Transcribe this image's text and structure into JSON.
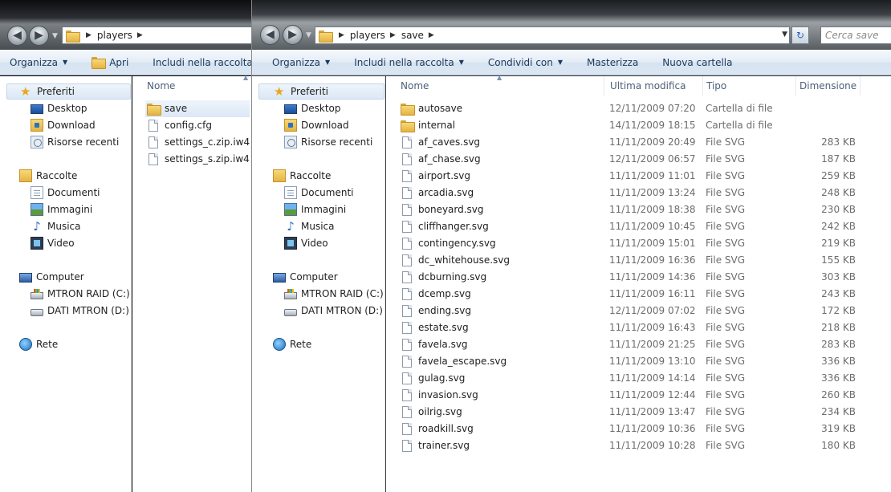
{
  "colors": {
    "toolbar_text": "#1e395b",
    "header_text": "#4c607a",
    "meta_text": "#6d6d6d",
    "selection": "#dbe8f6"
  },
  "left_window": {
    "path": [
      "players"
    ],
    "toolbar": [
      {
        "label": "Organizza",
        "dropdown": true,
        "icon": ""
      },
      {
        "label": "Apri",
        "dropdown": false,
        "icon": "open-folder-icon"
      },
      {
        "label": "Includi nella raccolta",
        "dropdown": true,
        "icon": ""
      }
    ],
    "column_name": "Nome",
    "files": [
      {
        "name": "save",
        "kind": "folder",
        "selected": true
      },
      {
        "name": "config.cfg",
        "kind": "file",
        "selected": false
      },
      {
        "name": "settings_c.zip.iw4",
        "kind": "file",
        "selected": false
      },
      {
        "name": "settings_s.zip.iw4",
        "kind": "file",
        "selected": false
      }
    ]
  },
  "right_window": {
    "path": [
      "players",
      "save"
    ],
    "search_placeholder": "Cerca save",
    "toolbar": [
      {
        "label": "Organizza",
        "dropdown": true
      },
      {
        "label": "Includi nella raccolta",
        "dropdown": true
      },
      {
        "label": "Condividi con",
        "dropdown": true
      },
      {
        "label": "Masterizza",
        "dropdown": false
      },
      {
        "label": "Nuova cartella",
        "dropdown": false
      }
    ],
    "columns": {
      "name": "Nome",
      "modified": "Ultima modifica",
      "type": "Tipo",
      "size": "Dimensione"
    },
    "files": [
      {
        "name": "autosave",
        "kind": "folder",
        "modified": "12/11/2009 07:20",
        "type": "Cartella di file",
        "size": ""
      },
      {
        "name": "internal",
        "kind": "folder",
        "modified": "14/11/2009 18:15",
        "type": "Cartella di file",
        "size": ""
      },
      {
        "name": "af_caves.svg",
        "kind": "file",
        "modified": "11/11/2009 20:49",
        "type": "File SVG",
        "size": "283 KB"
      },
      {
        "name": "af_chase.svg",
        "kind": "file",
        "modified": "12/11/2009 06:57",
        "type": "File SVG",
        "size": "187 KB"
      },
      {
        "name": "airport.svg",
        "kind": "file",
        "modified": "11/11/2009 11:01",
        "type": "File SVG",
        "size": "259 KB"
      },
      {
        "name": "arcadia.svg",
        "kind": "file",
        "modified": "11/11/2009 13:24",
        "type": "File SVG",
        "size": "248 KB"
      },
      {
        "name": "boneyard.svg",
        "kind": "file",
        "modified": "11/11/2009 18:38",
        "type": "File SVG",
        "size": "230 KB"
      },
      {
        "name": "cliffhanger.svg",
        "kind": "file",
        "modified": "11/11/2009 10:45",
        "type": "File SVG",
        "size": "242 KB"
      },
      {
        "name": "contingency.svg",
        "kind": "file",
        "modified": "11/11/2009 15:01",
        "type": "File SVG",
        "size": "219 KB"
      },
      {
        "name": "dc_whitehouse.svg",
        "kind": "file",
        "modified": "11/11/2009 16:36",
        "type": "File SVG",
        "size": "155 KB"
      },
      {
        "name": "dcburning.svg",
        "kind": "file",
        "modified": "11/11/2009 14:36",
        "type": "File SVG",
        "size": "303 KB"
      },
      {
        "name": "dcemp.svg",
        "kind": "file",
        "modified": "11/11/2009 16:11",
        "type": "File SVG",
        "size": "243 KB"
      },
      {
        "name": "ending.svg",
        "kind": "file",
        "modified": "12/11/2009 07:02",
        "type": "File SVG",
        "size": "172 KB"
      },
      {
        "name": "estate.svg",
        "kind": "file",
        "modified": "11/11/2009 16:43",
        "type": "File SVG",
        "size": "218 KB"
      },
      {
        "name": "favela.svg",
        "kind": "file",
        "modified": "11/11/2009 21:25",
        "type": "File SVG",
        "size": "283 KB"
      },
      {
        "name": "favela_escape.svg",
        "kind": "file",
        "modified": "11/11/2009 13:10",
        "type": "File SVG",
        "size": "336 KB"
      },
      {
        "name": "gulag.svg",
        "kind": "file",
        "modified": "11/11/2009 14:14",
        "type": "File SVG",
        "size": "336 KB"
      },
      {
        "name": "invasion.svg",
        "kind": "file",
        "modified": "11/11/2009 12:44",
        "type": "File SVG",
        "size": "260 KB"
      },
      {
        "name": "oilrig.svg",
        "kind": "file",
        "modified": "11/11/2009 13:47",
        "type": "File SVG",
        "size": "234 KB"
      },
      {
        "name": "roadkill.svg",
        "kind": "file",
        "modified": "11/11/2009 10:36",
        "type": "File SVG",
        "size": "319 KB"
      },
      {
        "name": "trainer.svg",
        "kind": "file",
        "modified": "11/11/2009 10:28",
        "type": "File SVG",
        "size": "180 KB"
      }
    ]
  },
  "nav": {
    "favorites": "Preferiti",
    "desktop": "Desktop",
    "download": "Download",
    "recent": "Risorse recenti",
    "libraries": "Raccolte",
    "documents": "Documenti",
    "images": "Immagini",
    "music": "Musica",
    "video": "Video",
    "computer": "Computer",
    "drive_c": "MTRON RAID (C:)",
    "drive_d": "DATI MTRON (D:)",
    "network": "Rete"
  }
}
